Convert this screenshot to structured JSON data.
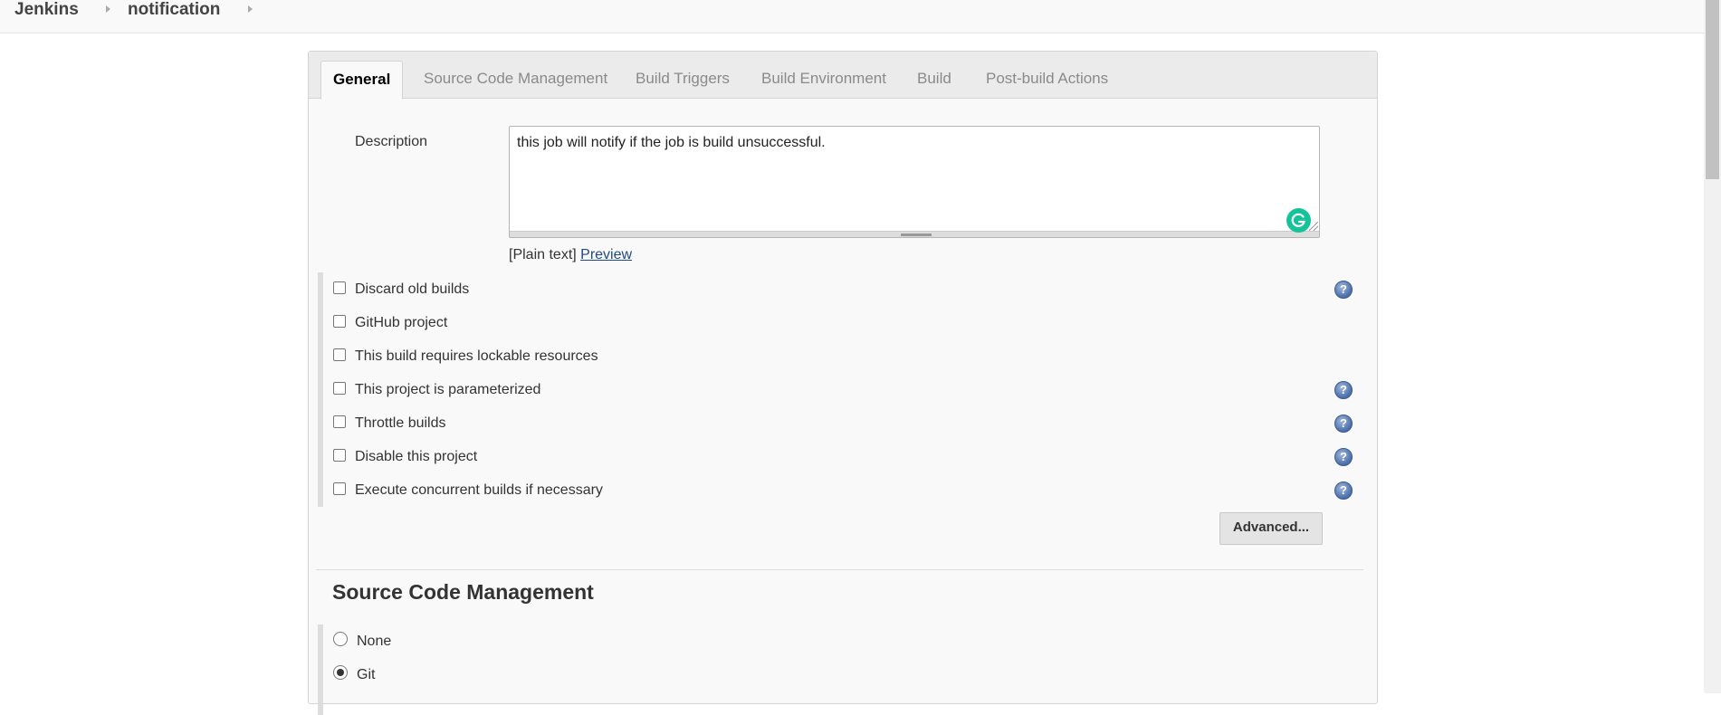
{
  "breadcrumb": {
    "items": [
      "Jenkins",
      "notification"
    ]
  },
  "tabs": [
    {
      "label": "General",
      "active": true
    },
    {
      "label": "Source Code Management",
      "active": false
    },
    {
      "label": "Build Triggers",
      "active": false
    },
    {
      "label": "Build Environment",
      "active": false
    },
    {
      "label": "Build",
      "active": false
    },
    {
      "label": "Post-build Actions",
      "active": false
    }
  ],
  "general": {
    "description_label": "Description",
    "description_value": "this job will notify if the job is build unsuccessful.",
    "format_prefix": "[Plain text]",
    "preview_link": "Preview",
    "options": [
      {
        "label": "Discard old builds",
        "checked": false,
        "help": true
      },
      {
        "label": "GitHub project",
        "checked": false,
        "help": false
      },
      {
        "label": "This build requires lockable resources",
        "checked": false,
        "help": false
      },
      {
        "label": "This project is parameterized",
        "checked": false,
        "help": true
      },
      {
        "label": "Throttle builds",
        "checked": false,
        "help": true
      },
      {
        "label": "Disable this project",
        "checked": false,
        "help": true
      },
      {
        "label": "Execute concurrent builds if necessary",
        "checked": false,
        "help": true
      }
    ],
    "advanced_button": "Advanced..."
  },
  "scm": {
    "title": "Source Code Management",
    "options": [
      {
        "label": "None",
        "selected": false
      },
      {
        "label": "Git",
        "selected": true
      }
    ]
  },
  "colors": {
    "grammarly": "#15c39a",
    "link": "#204a87"
  }
}
